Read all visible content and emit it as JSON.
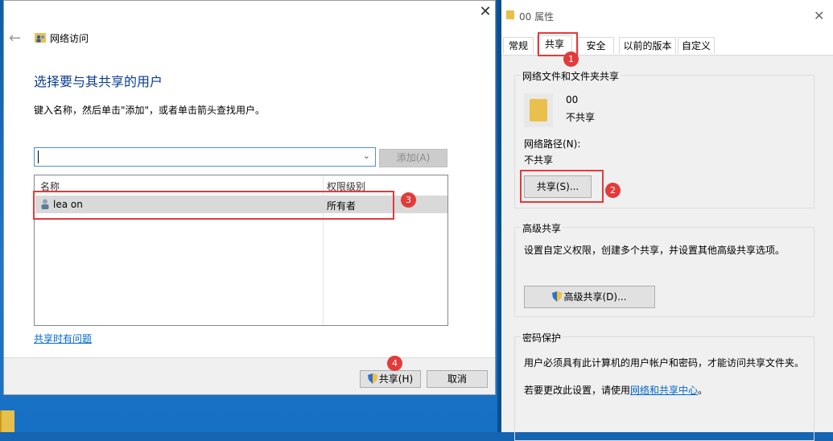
{
  "share_dialog": {
    "title": "网络访问",
    "heading": "选择要与其共享的用户",
    "instructions": "键入名称，然后单击\"添加\"，或者单击箭头查找用户。",
    "name_input_value": "",
    "add_button": "添加(A)",
    "columns": [
      "名称",
      "权限级别"
    ],
    "rows": [
      {
        "name": "lea   on",
        "permission": "所有者"
      }
    ],
    "help_link": "共享时有问题",
    "share_button": "共享(H)",
    "cancel_button": "取消",
    "close_glyph": "✕",
    "back_glyph": "←"
  },
  "properties_dialog": {
    "title": "00 属性",
    "tabs": [
      "常规",
      "共享",
      "安全",
      "以前的版本",
      "自定义"
    ],
    "active_tab": "共享",
    "network_group": {
      "label": "网络文件和文件夹共享",
      "folder_name": "00",
      "folder_status": "不共享",
      "path_label": "网络路径(N):",
      "path_value": "不共享",
      "share_button": "共享(S)..."
    },
    "advanced_group": {
      "label": "高级共享",
      "description": "设置自定义权限，创建多个共享，并设置其他高级共享选项。",
      "button": "高级共享(D)..."
    },
    "password_group": {
      "label": "密码保护",
      "description": "用户必须具有此计算机的用户帐户和密码，才能访问共享文件夹。",
      "change_prefix": "若要更改此设置，请使用",
      "change_link": "网络和共享中心",
      "change_suffix": "。"
    }
  },
  "annotations": [
    "1",
    "2",
    "3",
    "4"
  ],
  "colors": {
    "accent": "#0a3d91",
    "highlight": "#e23b3b",
    "link": "#0066cc"
  }
}
